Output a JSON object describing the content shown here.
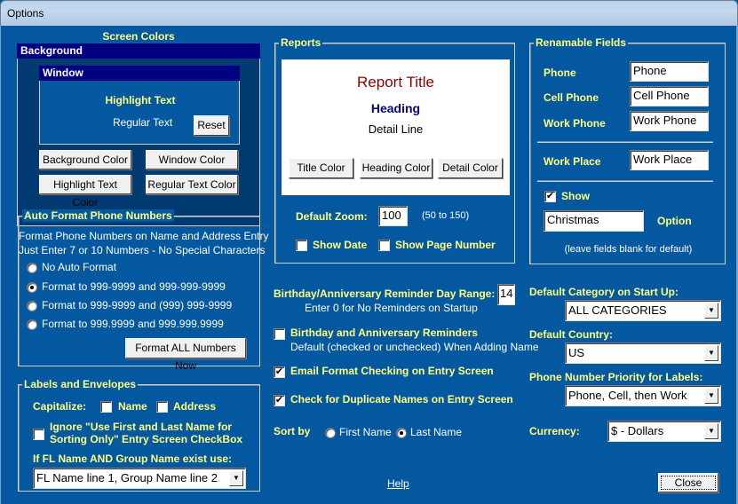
{
  "window": {
    "title": "Options"
  },
  "screen_colors": {
    "title": "Screen Colors",
    "background_label": "Background",
    "window_label": "Window",
    "highlight_text": "Highlight Text",
    "regular_text": "Regular Text",
    "reset_label": "Reset",
    "buttons": {
      "background_color": "Background Color",
      "window_color": "Window Color",
      "highlight_text_color": "Highlight Text Color",
      "regular_text_color": "Regular Text Color"
    },
    "colors": {
      "background": "#000080",
      "window": "#0458a0",
      "highlight": "#ffff80",
      "regular": "#ffffff"
    }
  },
  "auto_format": {
    "title": "Auto Format Phone Numbers",
    "desc_line1": "Format Phone Numbers on Name and Address Entry",
    "desc_line2": "Just Enter 7 or 10 Numbers - No Special Characters",
    "options": [
      {
        "label": "No Auto Format",
        "selected": false
      },
      {
        "label": "Format to 999-9999 and 999-999-9999",
        "selected": true
      },
      {
        "label": "Format to 999-9999 and (999) 999-9999",
        "selected": false
      },
      {
        "label": "Format to 999.9999 and 999.999.9999",
        "selected": false
      }
    ],
    "format_all_label": "Format ALL Numbers Now"
  },
  "labels_envelopes": {
    "title": "Labels and Envelopes",
    "capitalize_label": "Capitalize:",
    "name_label": "Name",
    "name_checked": false,
    "address_label": "Address",
    "address_checked": false,
    "ignore_line1": "Ignore \"Use First and Last Name for",
    "ignore_line2": "Sorting Only\"  Entry Screen CheckBox",
    "ignore_checked": false,
    "fl_group_label": "If FL Name AND Group Name exist use:",
    "fl_group_value": "FL Name line 1, Group Name line 2"
  },
  "reports": {
    "title": "Reports",
    "report_title": "Report Title",
    "heading": "Heading",
    "detail_line": "Detail Line",
    "title_color_label": "Title Color",
    "heading_color_label": "Heading Color",
    "detail_color_label": "Detail Color",
    "default_zoom_label": "Default Zoom:",
    "default_zoom_value": "100",
    "zoom_range": "(50 to 150)",
    "show_date_label": "Show Date",
    "show_date_checked": false,
    "show_page_number_label": "Show Page Number",
    "show_page_number_checked": false,
    "colors": {
      "title": "#8b0000",
      "heading": "#000080",
      "detail": "#000000"
    }
  },
  "reminders": {
    "range_label": "Birthday/Anniversary Reminder Day Range:",
    "range_value": "14",
    "range_note": "Enter 0 for No Reminders on Startup",
    "bday_label": "Birthday and Anniversary Reminders",
    "bday_note": "Default (checked or unchecked) When Adding Name",
    "bday_checked": false,
    "email_label": "Email Format Checking on Entry Screen",
    "email_checked": true,
    "duplicate_label": "Check for Duplicate Names on Entry Screen",
    "duplicate_checked": true,
    "sort_by_label": "Sort by",
    "sort_options": [
      {
        "label": "First Name",
        "selected": false
      },
      {
        "label": "Last Name",
        "selected": true
      }
    ]
  },
  "renamable": {
    "title": "Renamable Fields",
    "fields": [
      {
        "label": "Phone",
        "value": "Phone"
      },
      {
        "label": "Cell Phone",
        "value": "Cell Phone"
      },
      {
        "label": "Work Phone",
        "value": "Work Phone"
      },
      {
        "label": "Work Place",
        "value": "Work Place"
      }
    ],
    "show_label": "Show",
    "show_checked": true,
    "option_value": "Christmas",
    "option_label": "Option",
    "note": "(leave fields blank for default)"
  },
  "defaults": {
    "category_label": "Default Category on Start Up:",
    "category_value": "ALL CATEGORIES",
    "country_label": "Default Country:",
    "country_value": "US",
    "phone_priority_label": "Phone Number Priority for Labels:",
    "phone_priority_value": "Phone, Cell, then Work",
    "currency_label": "Currency:",
    "currency_value": "$ - Dollars"
  },
  "footer": {
    "help_label": "Help",
    "close_label": "Close"
  },
  "icons": {
    "dropdown": "▼",
    "check": "✔"
  }
}
